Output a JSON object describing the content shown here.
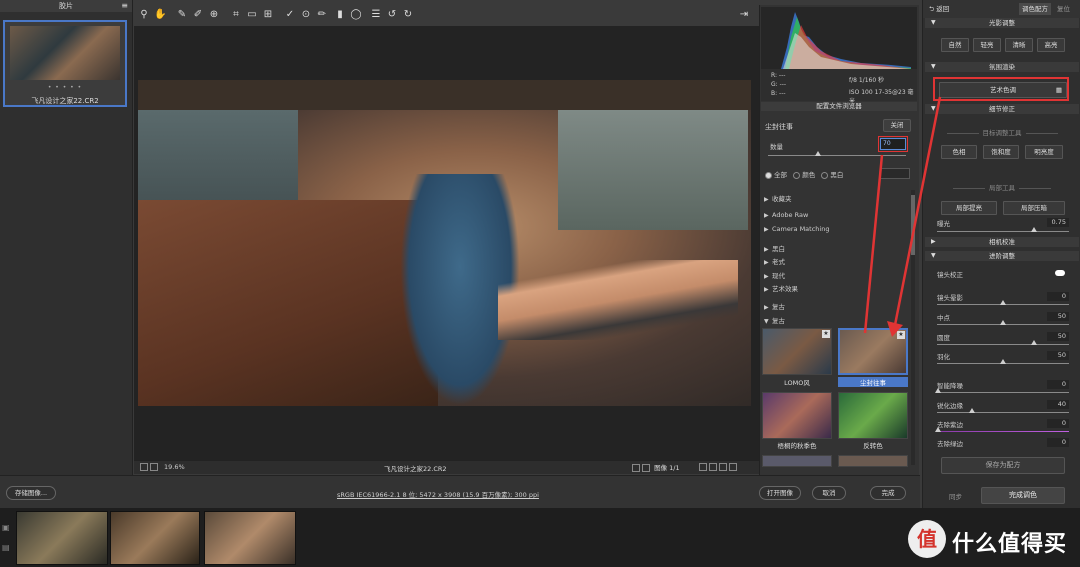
{
  "left_panel": {
    "title": "胶片",
    "thumb_name": "飞凡设计之家22.CR2",
    "stars": "• • • • •"
  },
  "toolbar": {
    "icons": [
      "zoom-icon",
      "hand-icon",
      "white-balance-icon",
      "color-sampler-icon",
      "target-adjust-icon",
      "crop-icon",
      "straighten-icon",
      "transform-icon",
      "spot-removal-icon",
      "red-eye-icon",
      "adjustment-brush-icon",
      "graduated-filter-icon",
      "radial-filter-icon",
      "list-icon",
      "rotate-left-icon",
      "rotate-right-icon"
    ]
  },
  "canvas_bar": {
    "zoom": "19.6%",
    "filename": "飞凡设计之家22.CR2",
    "image_nav": "图像 1/1"
  },
  "readout": {
    "r": "R:  ---",
    "g": "G:  ---",
    "b": "B:  ---",
    "line1": "f/8   1/160 秒",
    "line2": "ISO 100   17-35@23 毫米"
  },
  "profile_browser": {
    "title": "配置文件浏览器",
    "profile_name": "尘封往事",
    "close_label": "关闭",
    "amount_label": "数量",
    "amount_value": "70",
    "filters": [
      "全部",
      "颜色",
      "黑白"
    ],
    "categories": [
      "收藏夹",
      "Adobe Raw",
      "Camera Matching",
      "黑白",
      "老式",
      "现代",
      "艺术效果",
      "复古",
      "复古"
    ],
    "thumbs": [
      "LOMO风",
      "尘封往事",
      "梧桐的秋季色",
      "反转色"
    ]
  },
  "right_panel": {
    "back_label": "返回",
    "tab_active": "调色配方",
    "tab_reset": "复位",
    "sec_light": "光影调整",
    "light_buttons": [
      "自然",
      "轻亮",
      "清晰",
      "高亮"
    ],
    "sec_style": "氛围渲染",
    "style_button": "艺术色调",
    "sec_detail": "细节修正",
    "sub_target": "目标调整工具",
    "target_buttons": [
      "色相",
      "饱和度",
      "明亮度"
    ],
    "sub_local": "局部工具",
    "local_buttons": [
      "局部提亮",
      "局部压暗"
    ],
    "exposure_label": "曝光",
    "exposure_value": "0.75",
    "sec_camera": "相机校准",
    "sec_advanced": "进阶调整",
    "lens_label": "镜头校正",
    "rows": [
      {
        "label": "镜头晕影",
        "value": "0"
      },
      {
        "label": "中点",
        "value": "50"
      },
      {
        "label": "圆度",
        "value": "50"
      },
      {
        "label": "羽化",
        "value": "50"
      },
      {
        "label": "智能降噪",
        "value": "0"
      },
      {
        "label": "锐化边缘",
        "value": "40"
      },
      {
        "label": "去除紫边",
        "value": "0"
      },
      {
        "label": "去除绿边",
        "value": "0"
      }
    ],
    "save_label": "保存为配方",
    "sync_label": "同步",
    "finish_label": "完成调色"
  },
  "bottom": {
    "save_image": "存储图像...",
    "workflow": "sRGB IEC61966-2.1 8 位; 5472 x 3908 (15.9 百万像素); 300 ppi",
    "open": "打开图像",
    "cancel": "取消",
    "done": "完成"
  },
  "watermark": {
    "logo": "值",
    "text": "什么值得买"
  },
  "colors": {
    "accent": "#4a78c8",
    "highlight": "#e03434"
  }
}
